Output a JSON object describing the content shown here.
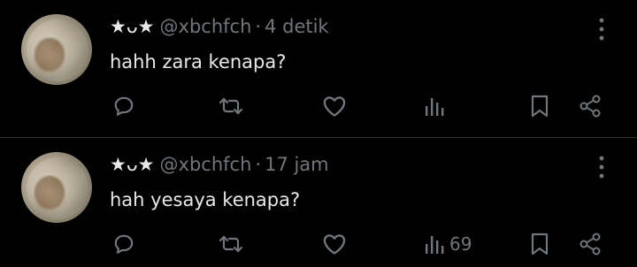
{
  "tweets": [
    {
      "display_name": "★ᴗ★",
      "handle": "@xbchfch",
      "separator": "·",
      "time": "4 detik",
      "text": "hahh zara kenapa?",
      "views_count": ""
    },
    {
      "display_name": "★ᴗ★",
      "handle": "@xbchfch",
      "separator": "·",
      "time": "17 jam",
      "text": "hah yesaya kenapa?",
      "views_count": "69"
    }
  ],
  "icons": {
    "reply": "reply-icon",
    "retweet": "retweet-icon",
    "like": "heart-icon",
    "views": "views-icon",
    "bookmark": "bookmark-icon",
    "share": "share-icon",
    "more": "more-icon"
  },
  "colors": {
    "background": "#000000",
    "text_primary": "#e7e9ea",
    "text_secondary": "#71767b",
    "divider": "#2f3336"
  }
}
